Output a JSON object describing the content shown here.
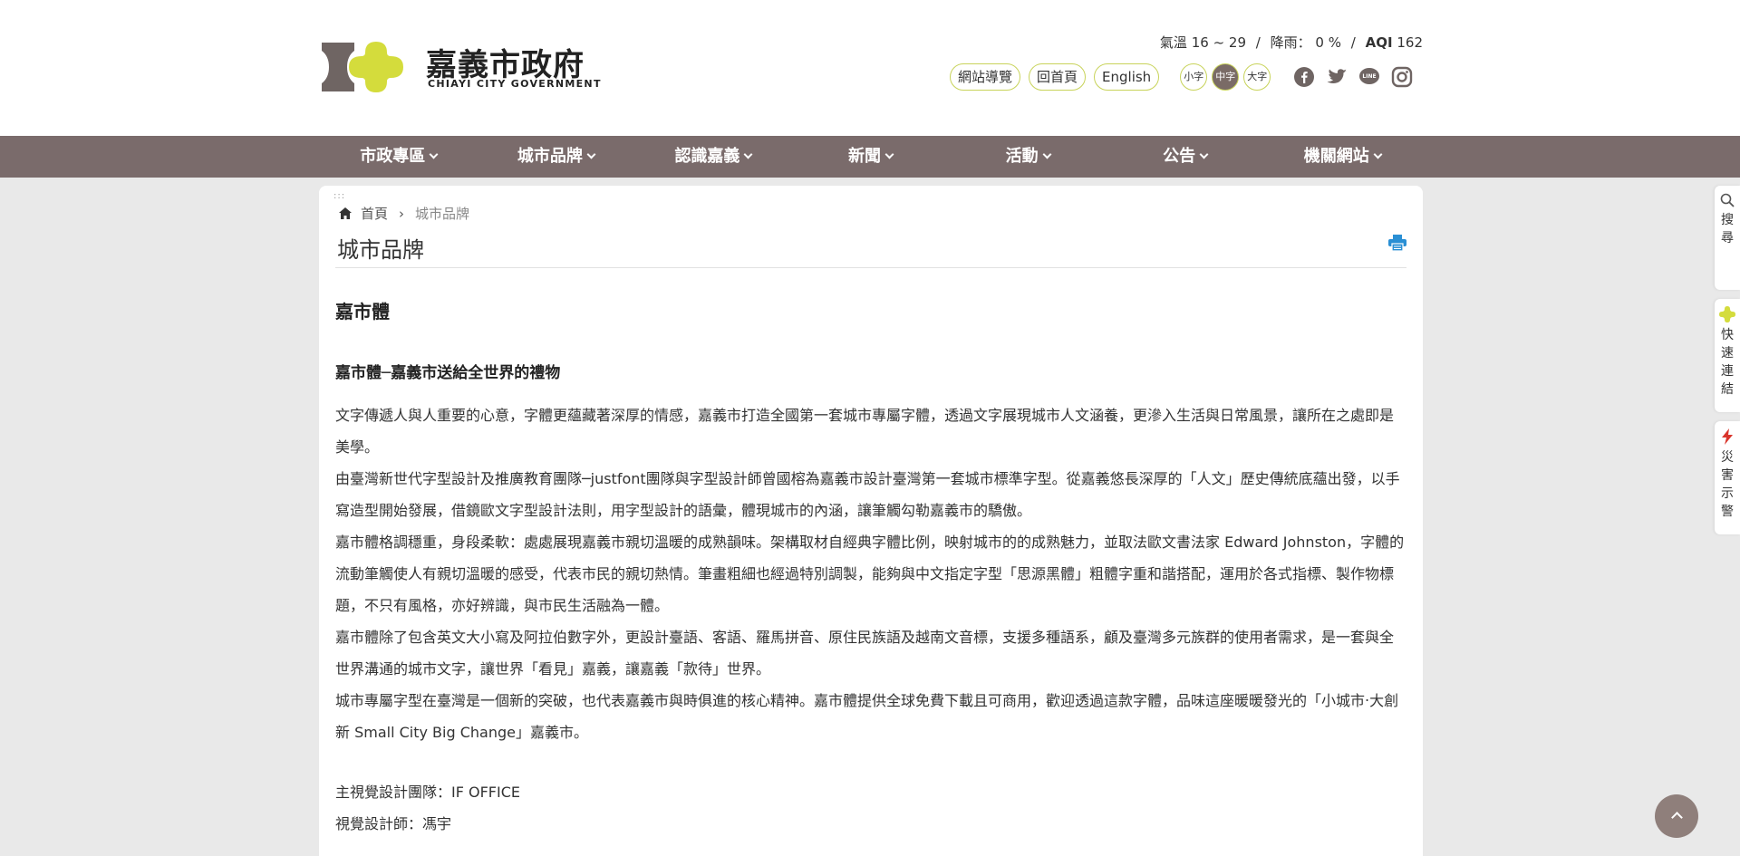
{
  "header": {
    "logo_cn": "嘉義市政府",
    "logo_en": "CHIAYI CITY GOVERNMENT",
    "weather": {
      "temp_label": "氣溫",
      "temp_value": "16 ~ 29",
      "rain_label": "降雨：",
      "rain_value": "0 %",
      "aqi_label": "AQI",
      "aqi_value": "162",
      "separator": "/"
    },
    "links": [
      "網站導覽",
      "回首頁",
      "English"
    ],
    "font_sizes": [
      {
        "label": "小字",
        "active": false
      },
      {
        "label": "中字",
        "active": true
      },
      {
        "label": "大字",
        "active": false
      }
    ],
    "social_icons": [
      "facebook-icon",
      "twitter-icon",
      "line-icon",
      "instagram-icon"
    ]
  },
  "nav": {
    "items": [
      "市政專區",
      "城市品牌",
      "認識嘉義",
      "新聞",
      "活動",
      "公告",
      "機關網站"
    ]
  },
  "content": {
    "dots": ":::",
    "breadcrumb": {
      "home": "首頁",
      "separator": "›",
      "current": "城市品牌"
    },
    "page_title": "城市品牌",
    "heading": "嘉市體",
    "subheading": "嘉市體─嘉義市送給全世界的禮物",
    "paragraphs": [
      "文字傳遞人與人重要的心意，字體更蘊藏著深厚的情感，嘉義市打造全國第一套城市專屬字體，透過文字展現城市人文涵養，更滲入生活與日常風景，讓所在之處即是美學。",
      "由臺灣新世代字型設計及推廣教育團隊─justfont團隊與字型設計師曾國榕為嘉義市設計臺灣第一套城市標準字型。從嘉義悠長深厚的「人文」歷史傳統底蘊出發，以手寫造型開始發展，借鏡歐文字型設計法則，用字型設計的語彙，體現城市的內涵，讓筆觸勾勒嘉義市的驕傲。",
      "嘉市體格調穩重，身段柔軟：處處展現嘉義市親切溫暖的成熟韻味。架構取材自經典字體比例，映射城市的的成熟魅力，並取法歐文書法家 Edward Johnston，字體的流動筆觸使人有親切溫暖的感受，代表市民的親切熱情。筆畫粗細也經過特別調製，能夠與中文指定字型「思源黑體」粗體字重和諧搭配，運用於各式指標、製作物標題，不只有風格，亦好辨識，與市民生活融為一體。",
      "嘉市體除了包含英文大小寫及阿拉伯數字外，更設計臺語、客語、羅馬拼音、原住民族語及越南文音標，支援多種語系，顧及臺灣多元族群的使用者需求，是一套與全世界溝通的城市文字，讓世界「看見」嘉義，讓嘉義「款待」世界。",
      "城市專屬字型在臺灣是一個新的突破，也代表嘉義市與時俱進的核心精神。嘉市體提供全球免費下載且可商用，歡迎透過這款字體，品味這座暖暖發光的「小城市‧大創新 Small City Big Change」嘉義市。"
    ],
    "credits": [
      "主視覺設計團隊：IF OFFICE",
      "視覺設計師：馮宇"
    ]
  },
  "side_tabs": {
    "search": [
      "搜",
      "尋"
    ],
    "quick": [
      "快",
      "速",
      "連",
      "結"
    ],
    "alert": [
      "災",
      "害",
      "示",
      "警"
    ]
  },
  "colors": {
    "nav_bg": "#7a6b6b",
    "accent_yellow": "#d4dc3c",
    "logo_gray": "#6f6563",
    "backtop": "#8f7f7b",
    "print_icon": "#2a8fd4",
    "alert_red": "#d9342b"
  }
}
